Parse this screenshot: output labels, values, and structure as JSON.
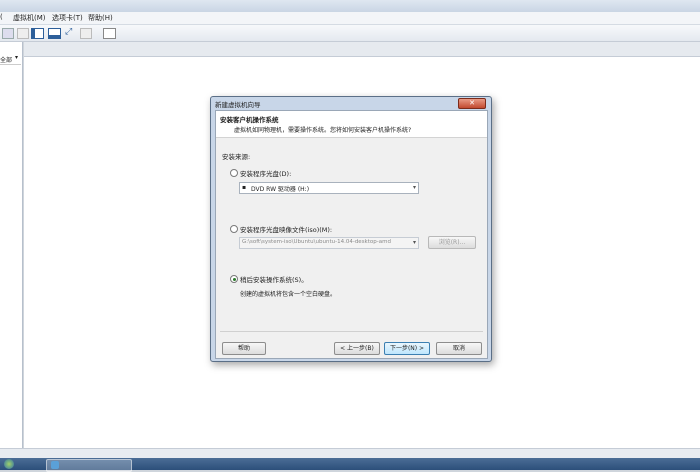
{
  "menu": {
    "vm": "虚拟机(M)",
    "tabs": "选项卡(T)",
    "help": "帮助(H)"
  },
  "sidebar": {
    "fragment": "全部"
  },
  "dialog": {
    "title": "新建虚拟机向导",
    "close": "✕",
    "heading": "安装客户机操作系统",
    "subheading": "虚拟机如同物理机，需要操作系统。您将如何安装客户机操作系统?",
    "source_label": "安装来源:",
    "opt_disc_label": "安装程序光盘(D):",
    "disc_value": "DVD RW 驱动器 (H:)",
    "opt_iso_label": "安装程序光盘映像文件(iso)(M):",
    "iso_value": "G:\\soft\\system-iso\\Ubuntu\\ubuntu-14.04-desktop-amd",
    "browse": "浏览(R)...",
    "opt_later_label": "稍后安装操作系统(S)。",
    "later_desc": "创建的虚拟机将包含一个空白硬盘。",
    "help": "帮助",
    "back": "< 上一步(B)",
    "next": "下一步(N) >",
    "cancel": "取消",
    "selected_option": "install_later"
  }
}
